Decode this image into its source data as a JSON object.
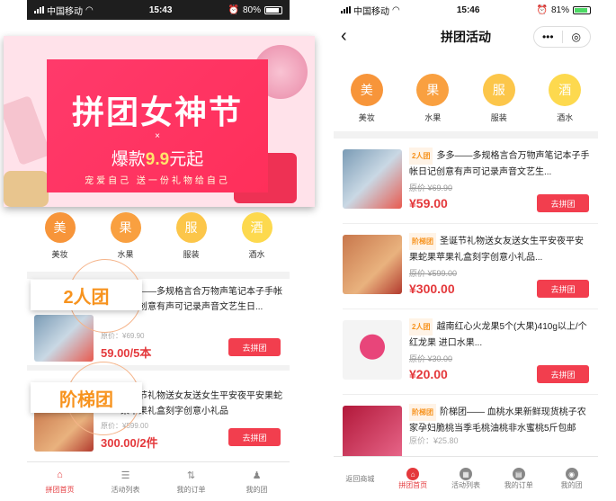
{
  "colors": {
    "accent": "#e4393c",
    "button": "#f23e4e",
    "badge": "#f7931e"
  },
  "left": {
    "status": {
      "carrier": "中国移动",
      "time": "15:43",
      "battery": "80%"
    },
    "banner": {
      "title": "拼团女神节",
      "x_mark": "×",
      "subtitle_pre": "爆款",
      "subtitle_price": "9.9",
      "subtitle_post": "元起",
      "slogan": "宠爱自己 送一份礼物给自己"
    },
    "categories": [
      {
        "char": "美",
        "label": "美妆",
        "color": "#f7953a"
      },
      {
        "char": "果",
        "label": "水果",
        "color": "#f9a040"
      },
      {
        "char": "服",
        "label": "服装",
        "color": "#fcc64a"
      },
      {
        "char": "酒",
        "label": "酒水",
        "color": "#fdd94e"
      }
    ],
    "items": [
      {
        "tag": "2人团",
        "title": "多多——多规格言合万物声笔记本子手帐日记创意有声可记录声音文艺生日...",
        "orig": "原价：¥69.90",
        "price": "59.00/5本",
        "button": "去拼团"
      },
      {
        "tag": "阶梯团",
        "title": "圣诞节礼物送女友送女生平安夜平安果蛇果苹果礼盒刻字创意小礼品",
        "orig": "原价：¥599.00",
        "price": "300.00/2件",
        "button": "去拼团"
      }
    ],
    "tabs": [
      {
        "label": "拼团首页",
        "icon": "⌂",
        "active": true
      },
      {
        "label": "活动列表",
        "icon": "☰"
      },
      {
        "label": "我的订单",
        "icon": "⇅"
      },
      {
        "label": "我的团",
        "icon": "♟"
      }
    ]
  },
  "right": {
    "status": {
      "carrier": "中国移动",
      "time": "15:46",
      "battery": "81%"
    },
    "nav": {
      "title": "拼团活动",
      "back": "‹",
      "more": "•••",
      "target": "◎"
    },
    "categories": [
      {
        "char": "美",
        "label": "美妆",
        "color": "#f7953a"
      },
      {
        "char": "果",
        "label": "水果",
        "color": "#f9a040"
      },
      {
        "char": "服",
        "label": "服装",
        "color": "#fcc64a"
      },
      {
        "char": "酒",
        "label": "酒水",
        "color": "#fdd94e"
      }
    ],
    "items": [
      {
        "badge": "2人团",
        "title": "多多——多规格言合万物声笔记本子手帐日记创意有声可记录声音文艺生...",
        "orig": "原价 ¥69.90",
        "price": "¥59.00",
        "button": "去拼团"
      },
      {
        "badge": "阶梯团",
        "title": "圣诞节礼物送女友送女生平安夜平安果蛇果苹果礼盒刻字创意小礼品...",
        "orig": "原价 ¥599.00",
        "price": "¥300.00",
        "button": "去拼团"
      },
      {
        "badge": "2人团",
        "title": "越南红心火龙果5个(大果)410g以上/个 红龙果 进口水果...",
        "orig": "原价 ¥30.00",
        "price": "¥20.00",
        "button": "去拼团"
      },
      {
        "badge": "阶梯团",
        "title": "阶梯团—— 血桃水果新鲜现货桃子农家孕妇脆桃当季毛桃油桃非水蜜桃5斤包邮",
        "orig": "原价：¥25.80",
        "price": "",
        "button": ""
      }
    ],
    "tabs": [
      {
        "label": "返回商城",
        "icon": ""
      },
      {
        "label": "拼团首页",
        "icon": "⌂",
        "active": true
      },
      {
        "label": "活动列表",
        "icon": "▦"
      },
      {
        "label": "我的订单",
        "icon": "▤"
      },
      {
        "label": "我的团",
        "icon": "◉"
      }
    ]
  }
}
